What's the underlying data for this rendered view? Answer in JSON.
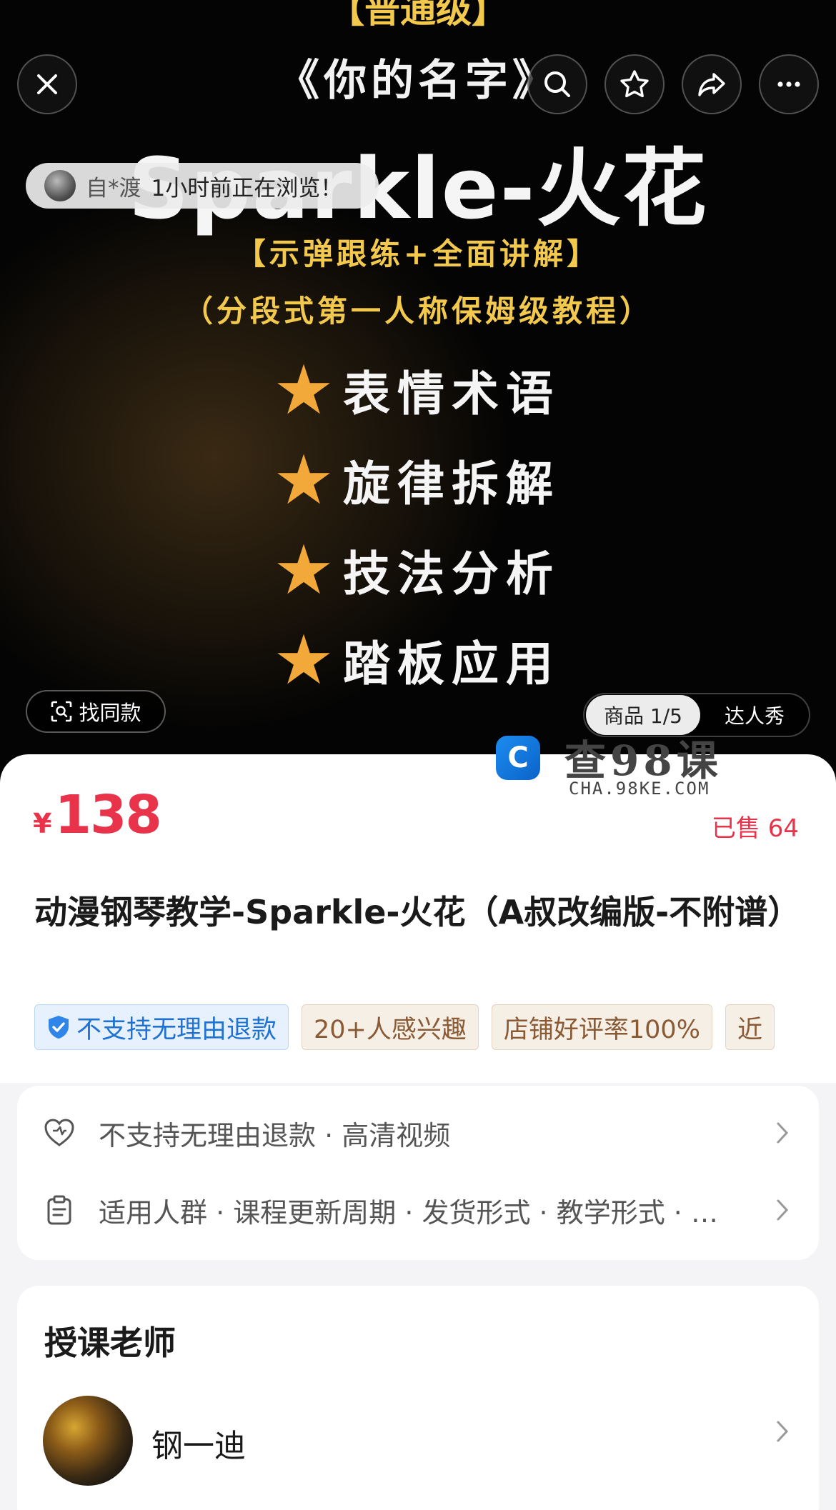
{
  "hero": {
    "tier": "【普通级】",
    "work_name": "《你的名字》",
    "song_title": "Sparkle-火花",
    "line1": "【示弹跟练+全面讲解】",
    "line2": "（分段式第一人称保姆级教程）",
    "features": [
      "表情术语",
      "旋律拆解",
      "技法分析",
      "踏板应用"
    ],
    "star_icon": "star-icon"
  },
  "top_bar": {
    "icons": [
      "close-icon",
      "search-icon",
      "star-outline-icon",
      "share-icon",
      "more-icon"
    ]
  },
  "browse": {
    "user": "自*渡",
    "text": "1小时前正在浏览！"
  },
  "find_same": {
    "label": "找同款",
    "icon": "scan-icon"
  },
  "media_tabs": {
    "active": "商品 1/5",
    "inactive": "达人秀"
  },
  "watermark": {
    "text": "查98课",
    "sub": "CHA.98KE.COM",
    "logo_glyph": "C"
  },
  "product": {
    "currency": "¥",
    "price": "138",
    "sold": "已售 64",
    "title": "动漫钢琴教学-Sparkle-火花（A叔改编版-不附谱）",
    "tags": [
      {
        "text": "不支持无理由退款",
        "style": "blue"
      },
      {
        "text": "20+人感兴趣",
        "style": "beige"
      },
      {
        "text": "店铺好评率100%",
        "style": "beige"
      },
      {
        "text": "近",
        "style": "beige"
      }
    ]
  },
  "info_card": {
    "row1": "不支持无理由退款 · 高清视频",
    "row2": "适用人群 · 课程更新周期 · 发货形式 · 教学形式 · …"
  },
  "teacher": {
    "section_title": "授课老师",
    "name": "钢一迪"
  },
  "colors": {
    "price_red": "#e8334a",
    "star_orange": "#f3a93a",
    "banner_yellow": "#f2c94c",
    "tag_blue": "#1f72d2"
  }
}
